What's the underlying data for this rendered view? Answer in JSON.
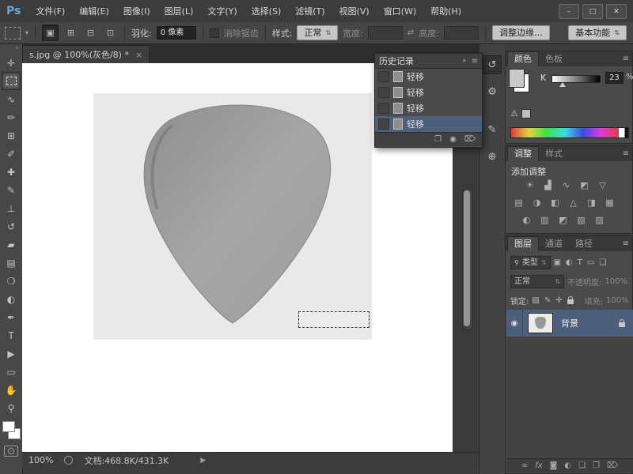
{
  "colors": {
    "selection_blue": "#4d5f7a",
    "panel_bg": "#4a4a4a",
    "canvas_white": "#ffffff",
    "photo_gray": "#e9e9e9",
    "pick_gray": "#a0a0a0",
    "logo_blue": "#6ca6d9"
  },
  "app": {
    "logo": "Ps",
    "menus": [
      "文件(F)",
      "编辑(E)",
      "图像(I)",
      "图层(L)",
      "文字(Y)",
      "选择(S)",
      "滤镜(T)",
      "视图(V)",
      "窗口(W)",
      "帮助(H)"
    ],
    "minimize": "–",
    "maximize": "□",
    "close": "✕"
  },
  "options_bar": {
    "preset_arrow": "▾",
    "mode_icons": [
      "▣",
      "⊞",
      "⊟",
      "⊡"
    ],
    "feather_label": "羽化:",
    "feather_value": "0 像素",
    "antialias_label": "消除锯齿",
    "style_label": "样式:",
    "style_value": "正常",
    "spinner": "⇅",
    "width_label": "宽度:",
    "swap_icon": "⇄",
    "height_label": "高度:",
    "refine_edge_label": "调整边缘…",
    "workspace_label": "基本功能"
  },
  "toolbar": {
    "collapse": "»",
    "tools": [
      {
        "name": "move-tool",
        "glyph": "✛"
      },
      {
        "name": "rectangular-marquee-tool",
        "glyph": ""
      },
      {
        "name": "lasso-tool",
        "glyph": "∿"
      },
      {
        "name": "quick-selection-tool",
        "glyph": "✏"
      },
      {
        "name": "crop-tool",
        "glyph": "⊞"
      },
      {
        "name": "eyedropper-tool",
        "glyph": "✐"
      },
      {
        "name": "spot-healing-brush-tool",
        "glyph": "✚"
      },
      {
        "name": "brush-tool",
        "glyph": "✎"
      },
      {
        "name": "clone-stamp-tool",
        "glyph": "⊥"
      },
      {
        "name": "history-brush-tool",
        "glyph": "↺"
      },
      {
        "name": "eraser-tool",
        "glyph": "▰"
      },
      {
        "name": "gradient-tool",
        "glyph": "▤"
      },
      {
        "name": "blur-tool",
        "glyph": "❍"
      },
      {
        "name": "dodge-tool",
        "glyph": "◐"
      },
      {
        "name": "pen-tool",
        "glyph": "✒"
      },
      {
        "name": "type-tool",
        "glyph": "T"
      },
      {
        "name": "path-selection-tool",
        "glyph": "▶"
      },
      {
        "name": "shape-tool",
        "glyph": "▭"
      },
      {
        "name": "hand-tool",
        "glyph": "✋"
      },
      {
        "name": "zoom-tool",
        "glyph": "⚲"
      }
    ]
  },
  "document": {
    "tab_title": "s.jpg @ 100%(灰色/8) *",
    "tab_close": "×",
    "status_zoom": "100%",
    "status_info": "文档:468.8K/431.3K",
    "status_arrow": "▶"
  },
  "history_panel": {
    "title": "历史记录",
    "collapse": "»",
    "menu": "≡",
    "items": [
      "轻移",
      "轻移",
      "轻移",
      "轻移"
    ],
    "selected_index": 3,
    "footer_icons": [
      {
        "name": "new-document-from-state",
        "glyph": "❐"
      },
      {
        "name": "new-snapshot",
        "glyph": "◉"
      },
      {
        "name": "delete-state",
        "glyph": "⌦"
      }
    ]
  },
  "dock": {
    "icons": [
      {
        "name": "history",
        "glyph": "↺"
      },
      {
        "name": "properties",
        "glyph": "⚙"
      },
      {
        "name": "brush-presets",
        "glyph": "✎"
      },
      {
        "name": "clone-source",
        "glyph": "⊕"
      }
    ]
  },
  "color_panel": {
    "tabs": [
      "颜色",
      "色板"
    ],
    "menu": "≡",
    "k_label": "K",
    "k_value": "23",
    "unit": "%",
    "gamut_warning": "⚠"
  },
  "adjust_panel": {
    "tabs": [
      "调整",
      "样式"
    ],
    "menu": "≡",
    "add_label": "添加调整",
    "row1": [
      "☀",
      "▟",
      "∿",
      "◩",
      "▽"
    ],
    "row2": [
      "▤",
      "◑",
      "◧",
      "△",
      "◨",
      "▦"
    ],
    "row3": [
      "◐",
      "▥",
      "◩",
      "▧",
      "▨"
    ]
  },
  "layers_panel": {
    "tabs": [
      "图层",
      "通道",
      "路径"
    ],
    "menu": "≡",
    "search_icon": "⚲",
    "filter_value": "类型",
    "spinner": "⇅",
    "filter_icons": [
      "▣",
      "◐",
      "T",
      "▭",
      "❏"
    ],
    "blend_mode": "正常",
    "opacity_label": "不透明度:",
    "opacity_value": "100%",
    "lock_label": "锁定:",
    "lock_icons": [
      "▨",
      "✎",
      "✛"
    ],
    "fill_label": "填充:",
    "fill_value": "100%",
    "eye_icon": "◉",
    "layer_name": "背景",
    "bottom_icons": [
      {
        "name": "link-layers",
        "glyph": "∞"
      },
      {
        "name": "layer-style",
        "glyph": "fx"
      },
      {
        "name": "add-layer-mask",
        "glyph": "◙"
      },
      {
        "name": "new-adjustment-layer",
        "glyph": "◐"
      },
      {
        "name": "new-group",
        "glyph": "❏"
      },
      {
        "name": "new-layer",
        "glyph": "❐"
      },
      {
        "name": "delete-layer",
        "glyph": "⌦"
      }
    ]
  }
}
